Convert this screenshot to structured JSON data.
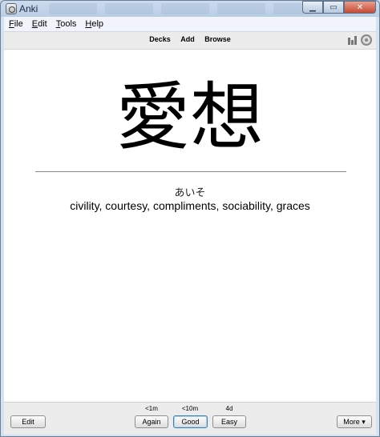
{
  "window": {
    "title": "Anki"
  },
  "menubar": {
    "items": [
      {
        "first": "F",
        "rest": "ile"
      },
      {
        "first": "E",
        "rest": "dit"
      },
      {
        "first": "T",
        "rest": "ools"
      },
      {
        "first": "H",
        "rest": "elp"
      }
    ]
  },
  "toolbar": {
    "decks": "Decks",
    "add": "Add",
    "browse": "Browse",
    "stats_icon": "bar-chart-icon",
    "sync_icon": "sync-icon"
  },
  "card": {
    "front": "愛想",
    "reading": "あいそ",
    "meaning": "civility, courtesy, compliments, sociability, graces"
  },
  "answer_bar": {
    "edit": "Edit",
    "more": "More ▾",
    "buttons": [
      {
        "interval": "<1m",
        "label": "Again"
      },
      {
        "interval": "<10m",
        "label": "Good"
      },
      {
        "interval": "4d",
        "label": "Easy"
      }
    ]
  },
  "colors": {
    "title_bar": "#b9cde5",
    "card_bg": "#ffffff",
    "focus_border": "#3c7fb1"
  }
}
